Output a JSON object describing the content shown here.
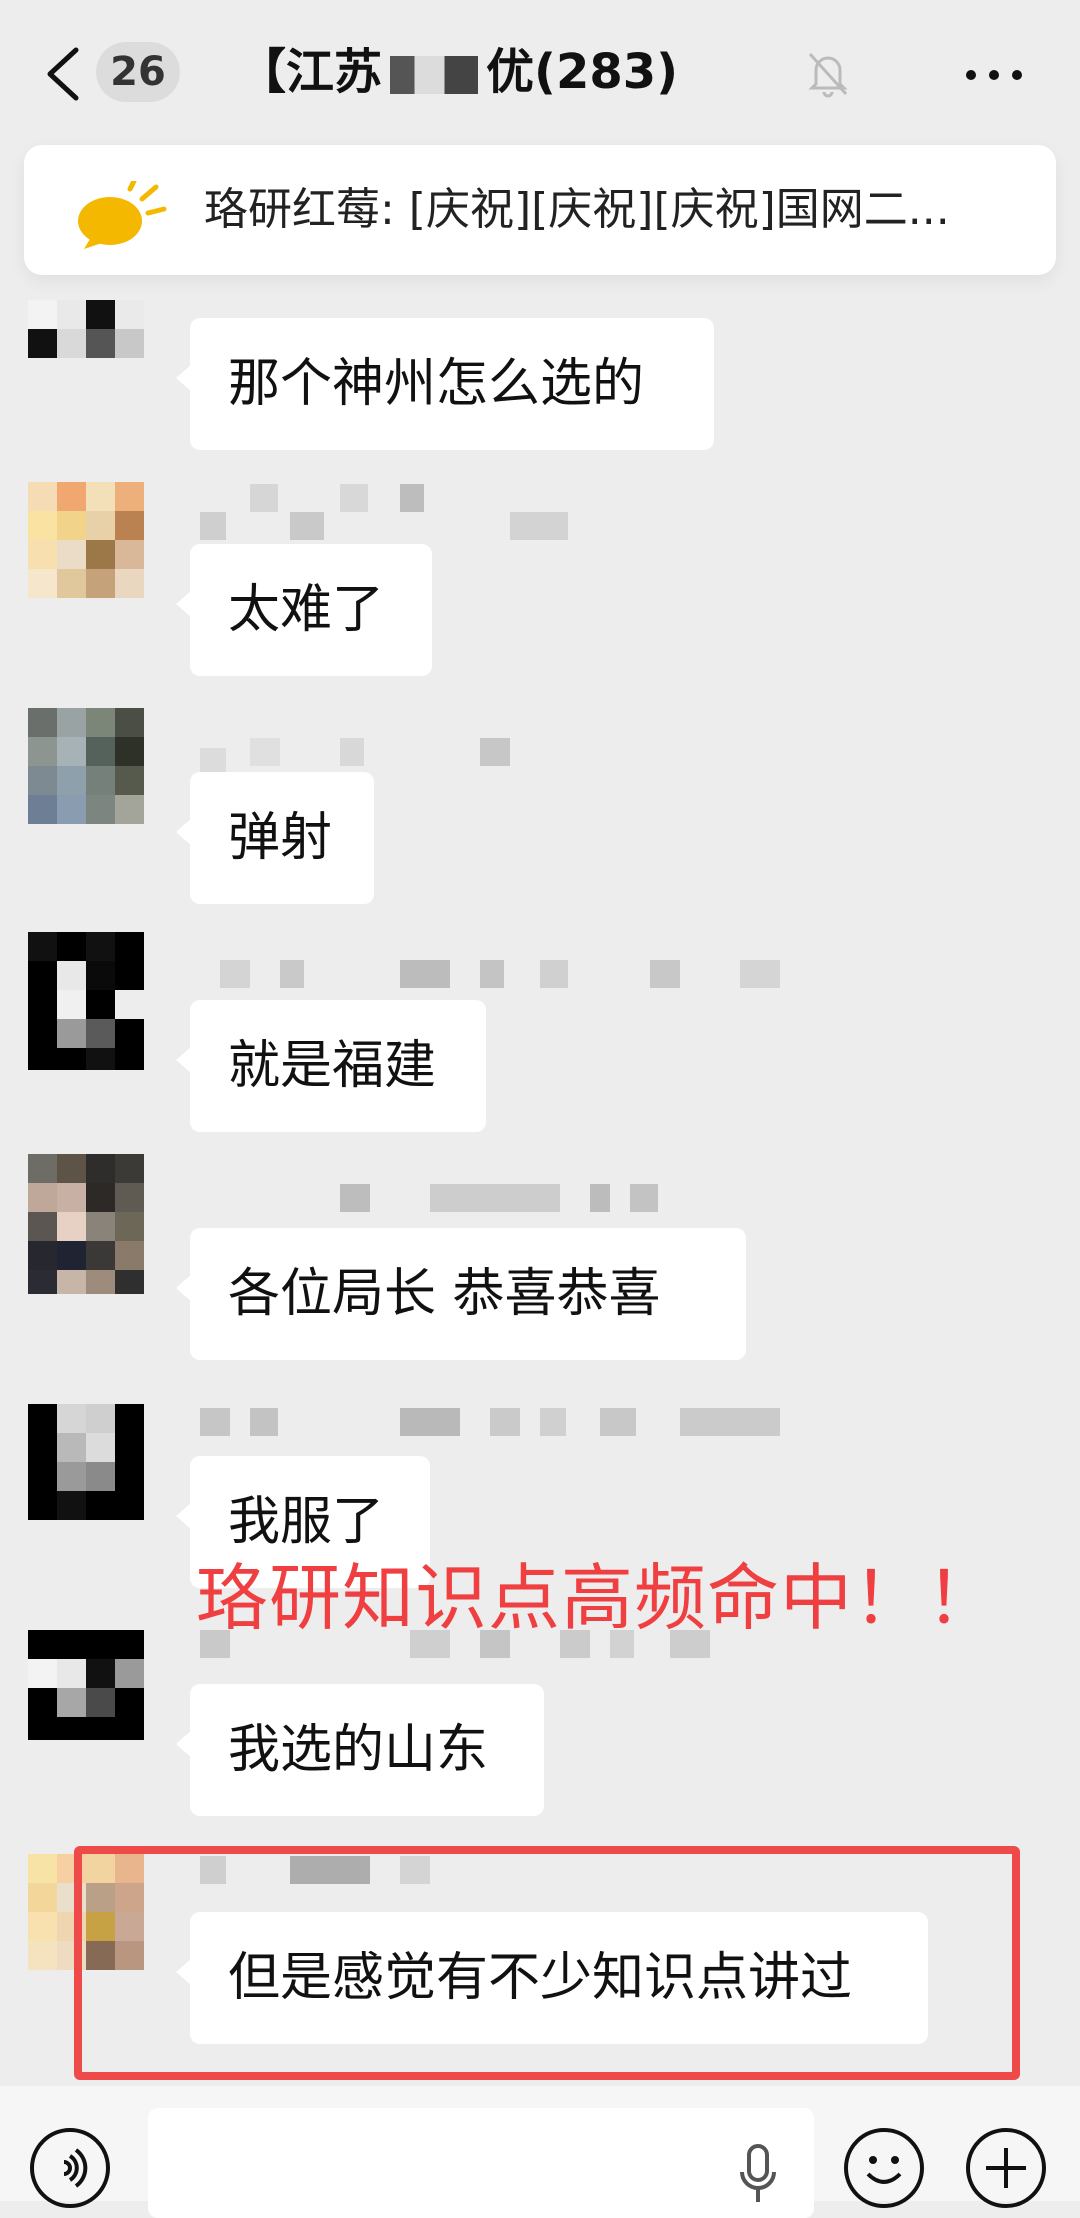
{
  "header": {
    "unread_count": "26",
    "title_prefix": "【江苏",
    "title_suffix": "优(283)"
  },
  "notice": {
    "text": "珞研红莓: [庆祝][庆祝][庆祝]国网二..."
  },
  "messages": [
    {
      "text": "那个神州怎么选的"
    },
    {
      "text": "太难了"
    },
    {
      "text": "弹射"
    },
    {
      "text": "就是福建"
    },
    {
      "text": "各位局长  恭喜恭喜"
    },
    {
      "text": "我服了"
    },
    {
      "text": "我选的山东"
    },
    {
      "text": "但是感觉有不少知识点讲过"
    }
  ],
  "overlay": {
    "text": "珞研知识点高频命中！！"
  },
  "icons": {
    "back": "chevron-left-icon",
    "mute": "bell-off-icon",
    "more": "more-icon",
    "notice": "speaker-icon",
    "voice": "voice-icon",
    "mic": "mic-icon",
    "emoji": "emoji-icon",
    "plus": "plus-icon"
  },
  "colors": {
    "background": "#ededed",
    "bubble": "#ffffff",
    "overlay_red": "#ef3f40",
    "highlight_border": "#ef4a4a",
    "notice_icon": "#f5b800"
  }
}
